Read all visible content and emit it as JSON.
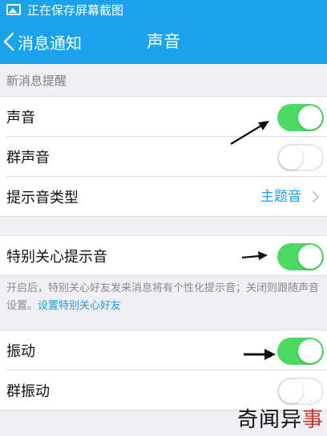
{
  "status_bar": {
    "text": "正在保存屏幕截图"
  },
  "nav": {
    "back_label": "消息通知",
    "title": "声音"
  },
  "section1": {
    "header": "新消息提醒"
  },
  "rows": {
    "sound": {
      "label": "声音",
      "state": "on"
    },
    "group_sound": {
      "label": "群声音",
      "state": "off"
    },
    "tone_type": {
      "label": "提示音类型",
      "value": "主题音"
    },
    "special_care": {
      "label": "特别关心提示音",
      "state": "on"
    },
    "vibrate": {
      "label": "振动",
      "state": "on"
    },
    "group_vibrate": {
      "label": "群振动",
      "state": "off"
    }
  },
  "note": {
    "text": "开启后，特别关心好友发来消息将有个性化提示音；关闭则跟随声音设置。",
    "link": "设置特别关心好友"
  },
  "watermark": {
    "part1": "奇闻异",
    "part2": "事"
  },
  "colors": {
    "accent": "#1aa2ec",
    "toggle_on": "#4cd964",
    "link": "#1a9ee6",
    "watermark_red": "#d0342c"
  },
  "icons": {
    "status": "image-icon",
    "back": "chevron-left-icon",
    "disclosure": "chevron-right-icon"
  }
}
